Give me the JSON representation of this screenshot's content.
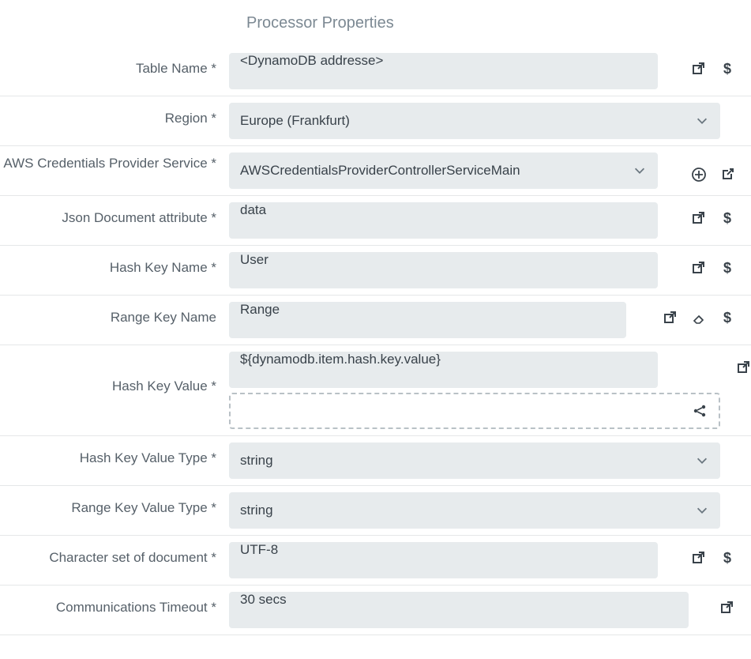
{
  "header": "Processor Properties",
  "rows": {
    "tableName": {
      "label": "Table Name *",
      "value": "<DynamoDB addresse>"
    },
    "region": {
      "label": "Region *",
      "value": "Europe (Frankfurt)"
    },
    "credentials": {
      "label": "AWS Credentials Provider Service *",
      "value": "AWSCredentialsProviderControllerServiceMain"
    },
    "jsonDoc": {
      "label": "Json Document attribute *",
      "value": "data"
    },
    "hashKeyName": {
      "label": "Hash Key Name *",
      "value": "User"
    },
    "rangeKeyName": {
      "label": "Range Key Name",
      "value": "Range"
    },
    "hashKeyValue": {
      "label": "Hash Key Value *",
      "value": "${dynamodb.item.hash.key.value}"
    },
    "hashKeyType": {
      "label": "Hash Key Value Type *",
      "value": "string"
    },
    "rangeKeyType": {
      "label": "Range Key Value Type *",
      "value": "string"
    },
    "charset": {
      "label": "Character set of document *",
      "value": "UTF-8"
    },
    "timeout": {
      "label": "Communications Timeout *",
      "value": "30 secs"
    }
  }
}
